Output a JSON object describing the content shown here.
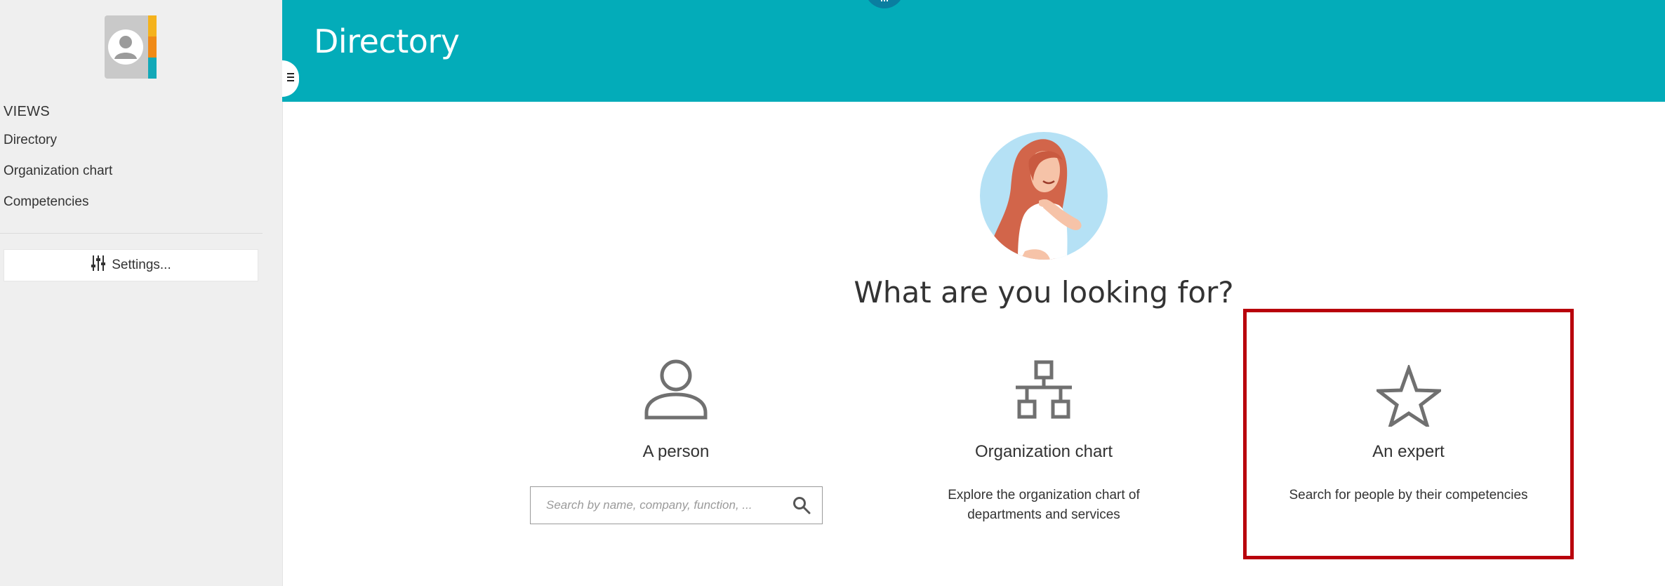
{
  "sidebar": {
    "views_title": "VIEWS",
    "items": [
      {
        "label": "Directory"
      },
      {
        "label": "Organization chart"
      },
      {
        "label": "Competencies"
      }
    ],
    "settings_label": "Settings..."
  },
  "header": {
    "title": "Directory"
  },
  "main": {
    "question": "What are you looking for?",
    "cards": [
      {
        "title": "A person",
        "icon": "person-icon"
      },
      {
        "title": "Organization chart",
        "description_line1": "Explore the organization chart of",
        "description_line2": "departments and services",
        "icon": "org-chart-icon"
      },
      {
        "title": "An expert",
        "description": "Search for people by their competencies",
        "icon": "star-icon"
      }
    ],
    "search": {
      "placeholder": "Search by name, company, function, ..."
    }
  },
  "colors": {
    "header_bg": "#03acb9",
    "sidebar_bg": "#efefef",
    "highlight_border": "#b8000c",
    "icon_gray": "#707070"
  }
}
